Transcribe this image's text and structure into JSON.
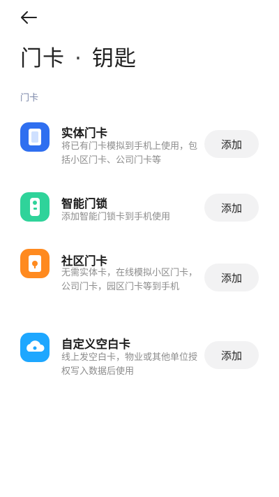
{
  "header": {
    "title_left": "门卡",
    "title_sep": "·",
    "title_right": "钥匙"
  },
  "section": {
    "label": "门卡"
  },
  "items": [
    {
      "title": "实体门卡",
      "desc": "将已有门卡模拟到手机上使用，包括小区门卡、公司门卡等",
      "button": "添加",
      "icon": "card-icon",
      "color": "#2f6ff0"
    },
    {
      "title": "智能门锁",
      "desc": "添加智能门锁卡到手机使用",
      "button": "添加",
      "icon": "smart-lock-icon",
      "color": "#2fd39a"
    },
    {
      "title": "社区门卡",
      "desc": "无需实体卡，在线模拟小区门卡，公司门卡，园区门卡等到手机",
      "button": "添加",
      "icon": "community-card-icon",
      "color": "#ff8a1f"
    },
    {
      "title": "自定义空白卡",
      "desc": "线上发空白卡，物业或其他单位授权写入数据后使用",
      "button": "添加",
      "icon": "cloud-card-icon",
      "color": "#1ea7ff"
    }
  ]
}
